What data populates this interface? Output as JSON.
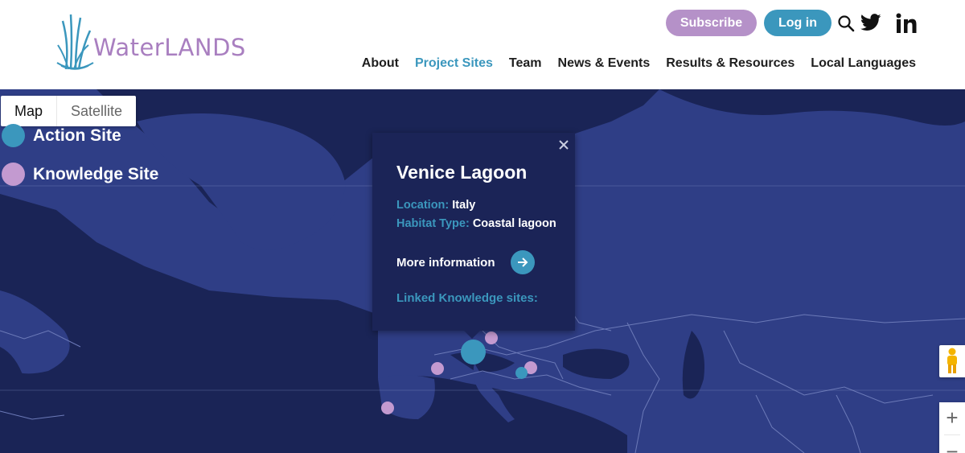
{
  "brand": {
    "name": "WaterLANDS",
    "logo_colors": {
      "reeds": "#3b97bd",
      "text": "#a97fc0"
    }
  },
  "header": {
    "subscribe_label": "Subscribe",
    "login_label": "Log in",
    "icons": [
      "search-icon",
      "twitter-icon",
      "linkedin-icon"
    ]
  },
  "nav": {
    "items": [
      {
        "label": "About",
        "active": false
      },
      {
        "label": "Project Sites",
        "active": true
      },
      {
        "label": "Team",
        "active": false
      },
      {
        "label": "News & Events",
        "active": false
      },
      {
        "label": "Results & Resources",
        "active": false
      },
      {
        "label": "Local Languages",
        "active": false
      }
    ]
  },
  "map": {
    "type_control": {
      "map_label": "Map",
      "satellite_label": "Satellite",
      "selected": "Map"
    },
    "legend": [
      {
        "label": "Action Site",
        "color": "#3b97bd"
      },
      {
        "label": "Knowledge Site",
        "color": "#c39ad0"
      }
    ],
    "popup": {
      "title": "Venice Lagoon",
      "location_key": "Location:",
      "location_value": "Italy",
      "habitat_key": "Habitat Type:",
      "habitat_value": "Coastal lagoon",
      "more_info_label": "More information",
      "linked_label": "Linked Knowledge sites:"
    },
    "colors": {
      "water": "#1a2456",
      "land": "#2f3e86",
      "borders": "#6c7ab8",
      "popup_bg": "#1b2457"
    },
    "zoom": {
      "in_label": "+",
      "out_label": "−"
    }
  }
}
